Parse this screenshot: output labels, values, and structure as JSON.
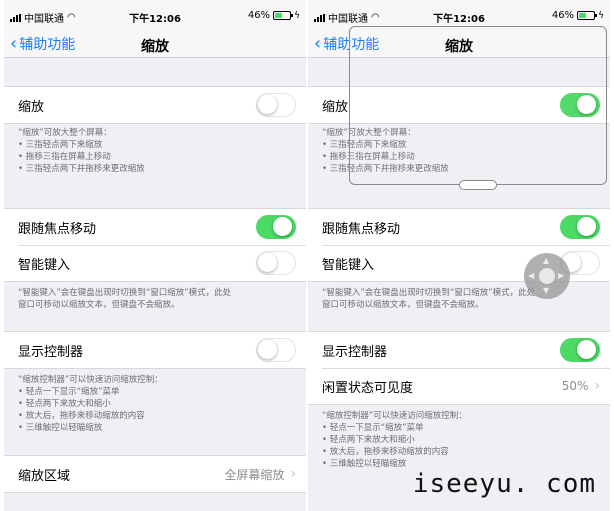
{
  "status_bar": {
    "carrier": "中国联通",
    "time": "下午12:06",
    "battery": "46%"
  },
  "nav": {
    "back_label": "辅助功能",
    "title": "缩放"
  },
  "left": {
    "zoom_label": "缩放",
    "zoom_on": false,
    "zoom_footer": {
      "intro": "“缩放”可放大整个屏幕：",
      "bullets": [
        "三指轻点两下来缩放",
        "拖移三指在屏幕上移动",
        "三指轻点两下并拖移来更改缩放"
      ]
    },
    "follow_focus_label": "跟随焦点移动",
    "follow_focus_on": true,
    "smart_typing_label": "智能键入",
    "smart_typing_on": false,
    "smart_footer": [
      "“智能键入”会在键盘出现时切换到“窗口缩放”模式，此处",
      "窗口可移动以缩放文本，但键盘不会缩放。"
    ],
    "controller_label": "显示控制器",
    "controller_on": false,
    "controller_footer": {
      "intro": "“缩放控制器”可以快速访问缩放控制：",
      "bullets": [
        "轻点一下显示“缩放”菜单",
        "轻点两下来放大和缩小",
        "放大后，拖移来移动缩放的内容",
        "三维触控以轻瞄缩放"
      ]
    },
    "region_label": "缩放区域",
    "region_value": "全屏幕缩放"
  },
  "right": {
    "zoom_label": "缩放",
    "zoom_on": true,
    "zoom_footer": {
      "intro": "“缩放”可放大整个屏幕：",
      "bullets": [
        "三指轻点两下来缩放",
        "拖移三指在屏幕上移动",
        "三指轻点两下并拖移来更改缩放"
      ]
    },
    "follow_focus_label": "跟随焦点移动",
    "follow_focus_on": true,
    "smart_typing_label": "智能键入",
    "smart_typing_on": false,
    "smart_footer": [
      "“智能键入”会在键盘出现时切换到“窗口缩放”模式，此处",
      "窗口可移动以缩放文本，但键盘不会缩放。"
    ],
    "controller_label": "显示控制器",
    "controller_on": true,
    "idle_label": "闲置状态可见度",
    "idle_value": "50%",
    "controller_footer": {
      "intro": "“缩放控制器”可以快速访问缩放控制：",
      "bullets": [
        "轻点一下显示“缩放”菜单",
        "轻点两下来放大和缩小",
        "放大后，拖移来移动缩放的内容",
        "三维触控以轻瞄缩放"
      ]
    }
  },
  "watermark": "iseeyu. com",
  "colors": {
    "accent": "#1b7cf5",
    "toggle_on": "#4cd964",
    "background": "#efeff4"
  },
  "icons": {
    "back": "chevron-left-icon",
    "disclosure": "chevron-right-icon",
    "controller": "zoom-controller-icon"
  }
}
